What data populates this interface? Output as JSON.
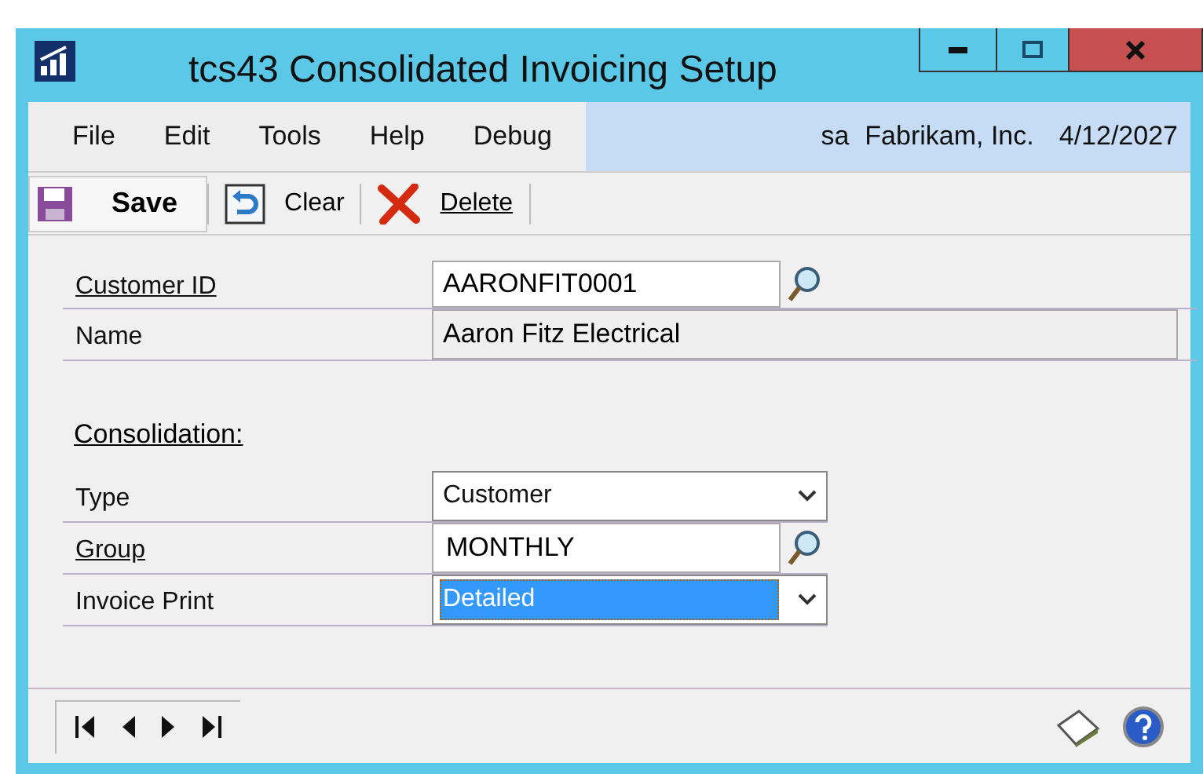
{
  "window": {
    "title": "tcs43 Consolidated Invoicing Setup"
  },
  "menu": [
    "File",
    "Edit",
    "Tools",
    "Help",
    "Debug"
  ],
  "session": {
    "user": "sa",
    "company": "Fabrikam, Inc.",
    "date": "4/12/2027"
  },
  "toolbar": [
    {
      "kind": "save",
      "label": "Save"
    },
    {
      "kind": "clear",
      "label": "Clear"
    },
    {
      "kind": "delete",
      "label": "Delete"
    }
  ],
  "customer_fields": [
    {
      "label": "Customer ID",
      "linked": true,
      "kind": "lookup",
      "value": "AARONFIT0001"
    },
    {
      "label": "Name",
      "linked": false,
      "kind": "readonly",
      "value": "Aaron Fitz Electrical"
    }
  ],
  "section_title": "Consolidation:",
  "consolidation_fields": [
    {
      "label": "Type",
      "linked": false,
      "kind": "dropdown",
      "value": "Customer",
      "focused": false
    },
    {
      "label": "Group",
      "linked": true,
      "kind": "lookup",
      "value": "MONTHLY"
    },
    {
      "label": "Invoice Print",
      "linked": false,
      "kind": "dropdown",
      "value": "Detailed",
      "focused": true
    }
  ]
}
